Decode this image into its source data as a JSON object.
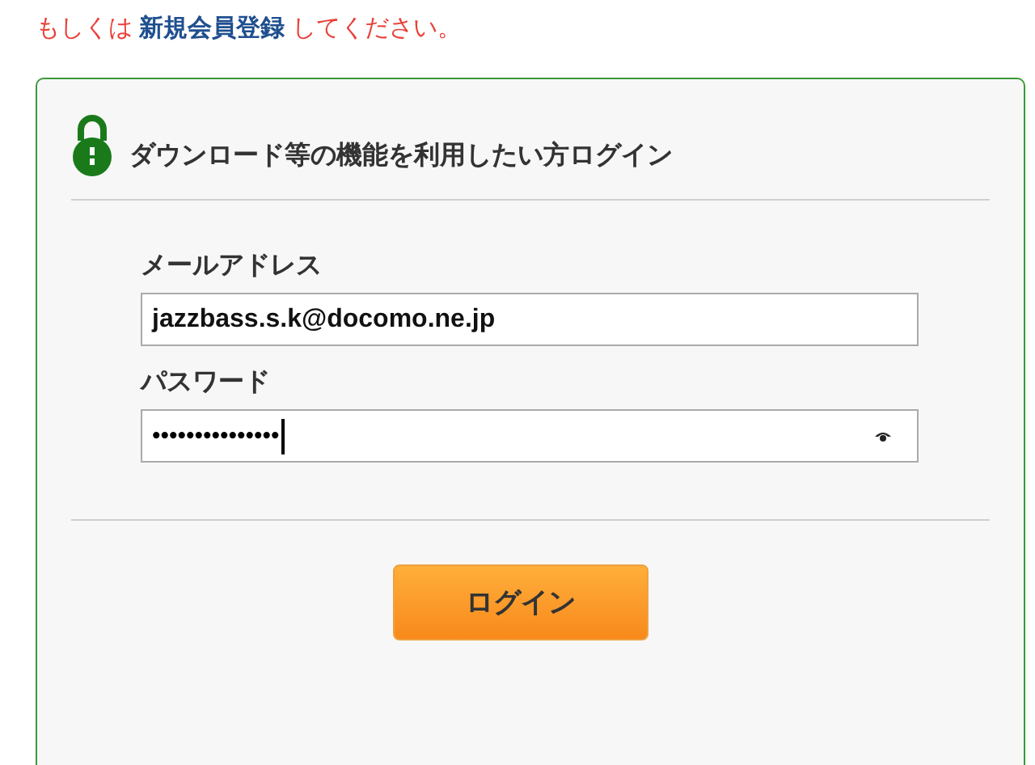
{
  "notice": {
    "before": "もしくは",
    "link": "新規会員登録",
    "after": "してください。"
  },
  "login_panel": {
    "heading": "ダウンロード等の機能を利用したい方ログイン",
    "fields": [
      {
        "label": "メールアドレス",
        "value": "jazzbass.s.k@docomo.ne.jp",
        "kind": "text"
      },
      {
        "label": "パスワード",
        "value": "•••••••••••••••",
        "kind": "password"
      }
    ],
    "button": "ログイン"
  }
}
